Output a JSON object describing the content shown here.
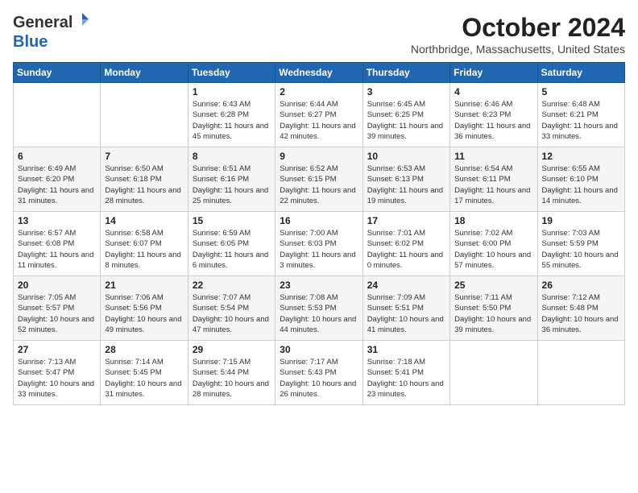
{
  "header": {
    "logo": {
      "text1": "General",
      "text2": "Blue"
    },
    "title": "October 2024",
    "location": "Northbridge, Massachusetts, United States"
  },
  "days_of_week": [
    "Sunday",
    "Monday",
    "Tuesday",
    "Wednesday",
    "Thursday",
    "Friday",
    "Saturday"
  ],
  "weeks": [
    [
      {
        "day": "",
        "info": ""
      },
      {
        "day": "",
        "info": ""
      },
      {
        "day": "1",
        "info": "Sunrise: 6:43 AM\nSunset: 6:28 PM\nDaylight: 11 hours and 45 minutes."
      },
      {
        "day": "2",
        "info": "Sunrise: 6:44 AM\nSunset: 6:27 PM\nDaylight: 11 hours and 42 minutes."
      },
      {
        "day": "3",
        "info": "Sunrise: 6:45 AM\nSunset: 6:25 PM\nDaylight: 11 hours and 39 minutes."
      },
      {
        "day": "4",
        "info": "Sunrise: 6:46 AM\nSunset: 6:23 PM\nDaylight: 11 hours and 36 minutes."
      },
      {
        "day": "5",
        "info": "Sunrise: 6:48 AM\nSunset: 6:21 PM\nDaylight: 11 hours and 33 minutes."
      }
    ],
    [
      {
        "day": "6",
        "info": "Sunrise: 6:49 AM\nSunset: 6:20 PM\nDaylight: 11 hours and 31 minutes."
      },
      {
        "day": "7",
        "info": "Sunrise: 6:50 AM\nSunset: 6:18 PM\nDaylight: 11 hours and 28 minutes."
      },
      {
        "day": "8",
        "info": "Sunrise: 6:51 AM\nSunset: 6:16 PM\nDaylight: 11 hours and 25 minutes."
      },
      {
        "day": "9",
        "info": "Sunrise: 6:52 AM\nSunset: 6:15 PM\nDaylight: 11 hours and 22 minutes."
      },
      {
        "day": "10",
        "info": "Sunrise: 6:53 AM\nSunset: 6:13 PM\nDaylight: 11 hours and 19 minutes."
      },
      {
        "day": "11",
        "info": "Sunrise: 6:54 AM\nSunset: 6:11 PM\nDaylight: 11 hours and 17 minutes."
      },
      {
        "day": "12",
        "info": "Sunrise: 6:55 AM\nSunset: 6:10 PM\nDaylight: 11 hours and 14 minutes."
      }
    ],
    [
      {
        "day": "13",
        "info": "Sunrise: 6:57 AM\nSunset: 6:08 PM\nDaylight: 11 hours and 11 minutes."
      },
      {
        "day": "14",
        "info": "Sunrise: 6:58 AM\nSunset: 6:07 PM\nDaylight: 11 hours and 8 minutes."
      },
      {
        "day": "15",
        "info": "Sunrise: 6:59 AM\nSunset: 6:05 PM\nDaylight: 11 hours and 6 minutes."
      },
      {
        "day": "16",
        "info": "Sunrise: 7:00 AM\nSunset: 6:03 PM\nDaylight: 11 hours and 3 minutes."
      },
      {
        "day": "17",
        "info": "Sunrise: 7:01 AM\nSunset: 6:02 PM\nDaylight: 11 hours and 0 minutes."
      },
      {
        "day": "18",
        "info": "Sunrise: 7:02 AM\nSunset: 6:00 PM\nDaylight: 10 hours and 57 minutes."
      },
      {
        "day": "19",
        "info": "Sunrise: 7:03 AM\nSunset: 5:59 PM\nDaylight: 10 hours and 55 minutes."
      }
    ],
    [
      {
        "day": "20",
        "info": "Sunrise: 7:05 AM\nSunset: 5:57 PM\nDaylight: 10 hours and 52 minutes."
      },
      {
        "day": "21",
        "info": "Sunrise: 7:06 AM\nSunset: 5:56 PM\nDaylight: 10 hours and 49 minutes."
      },
      {
        "day": "22",
        "info": "Sunrise: 7:07 AM\nSunset: 5:54 PM\nDaylight: 10 hours and 47 minutes."
      },
      {
        "day": "23",
        "info": "Sunrise: 7:08 AM\nSunset: 5:53 PM\nDaylight: 10 hours and 44 minutes."
      },
      {
        "day": "24",
        "info": "Sunrise: 7:09 AM\nSunset: 5:51 PM\nDaylight: 10 hours and 41 minutes."
      },
      {
        "day": "25",
        "info": "Sunrise: 7:11 AM\nSunset: 5:50 PM\nDaylight: 10 hours and 39 minutes."
      },
      {
        "day": "26",
        "info": "Sunrise: 7:12 AM\nSunset: 5:48 PM\nDaylight: 10 hours and 36 minutes."
      }
    ],
    [
      {
        "day": "27",
        "info": "Sunrise: 7:13 AM\nSunset: 5:47 PM\nDaylight: 10 hours and 33 minutes."
      },
      {
        "day": "28",
        "info": "Sunrise: 7:14 AM\nSunset: 5:45 PM\nDaylight: 10 hours and 31 minutes."
      },
      {
        "day": "29",
        "info": "Sunrise: 7:15 AM\nSunset: 5:44 PM\nDaylight: 10 hours and 28 minutes."
      },
      {
        "day": "30",
        "info": "Sunrise: 7:17 AM\nSunset: 5:43 PM\nDaylight: 10 hours and 26 minutes."
      },
      {
        "day": "31",
        "info": "Sunrise: 7:18 AM\nSunset: 5:41 PM\nDaylight: 10 hours and 23 minutes."
      },
      {
        "day": "",
        "info": ""
      },
      {
        "day": "",
        "info": ""
      }
    ]
  ]
}
